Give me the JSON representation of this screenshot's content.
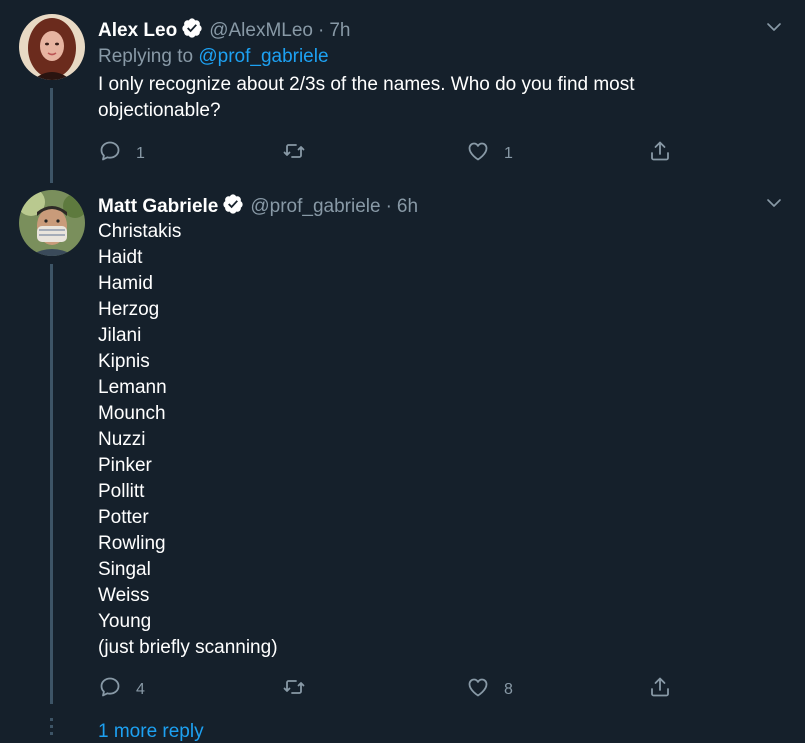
{
  "tweets": [
    {
      "name": "Alex Leo",
      "handle": "@AlexMLeo",
      "dot": "·",
      "time": "7h",
      "reply_label": "Replying to",
      "reply_handle": "@prof_gabriele",
      "text_lines": [
        "I only recognize about 2/3s of the names. Who do you find most",
        "objectionable?"
      ],
      "reply_count": "1",
      "retweet_count": "",
      "like_count": "1"
    },
    {
      "name": "Matt Gabriele",
      "handle": "@prof_gabriele",
      "dot": "·",
      "time": "6h",
      "text_lines": [
        "Christakis",
        "Haidt",
        "Hamid",
        "Herzog",
        "Jilani",
        "Kipnis",
        "Lemann",
        "Mounch",
        "Nuzzi",
        "Pinker",
        "Pollitt",
        "Potter",
        "Rowling",
        "Singal",
        "Weiss",
        "Young",
        "(just briefly scanning)"
      ],
      "reply_count": "4",
      "retweet_count": "",
      "like_count": "8"
    }
  ],
  "more_replies": "1 more reply",
  "icons": {
    "verified": "verified-badge-icon",
    "caret": "chevron-down-icon",
    "reply": "reply-icon",
    "retweet": "retweet-icon",
    "like": "heart-icon",
    "share": "share-icon"
  },
  "colors": {
    "background": "#15202b",
    "text": "#ffffff",
    "muted": "#8899a6",
    "link": "#1da1f2",
    "thread_line": "#3d5466"
  }
}
